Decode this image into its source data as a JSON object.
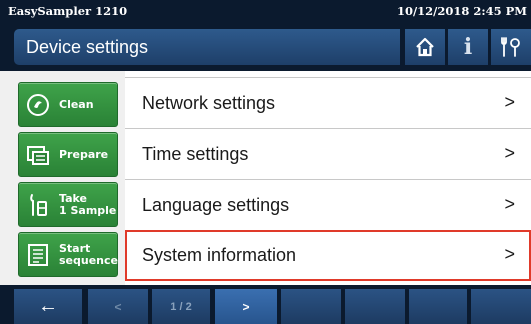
{
  "status": {
    "device_name": "EasySampler 1210",
    "datetime": "10/12/2018 2:45 PM"
  },
  "header": {
    "title": "Device settings",
    "buttons": [
      {
        "icon": "home-icon"
      },
      {
        "icon": "info-icon",
        "glyph": "i"
      },
      {
        "icon": "tools-icon"
      }
    ]
  },
  "sidebar": {
    "items": [
      {
        "label": "Clean",
        "icon": "clean-icon"
      },
      {
        "label": "Prepare",
        "icon": "prepare-icon"
      },
      {
        "label": "Take\n1 Sample",
        "icon": "take-sample-icon"
      },
      {
        "label": "Start\nsequence",
        "icon": "start-sequence-icon"
      }
    ]
  },
  "menu": {
    "items": [
      {
        "label": "Network settings",
        "chevron": ">"
      },
      {
        "label": "Time settings",
        "chevron": ">"
      },
      {
        "label": "Language settings",
        "chevron": ">"
      },
      {
        "label": "System information",
        "chevron": ">",
        "selected": true
      }
    ]
  },
  "footer": {
    "back_glyph": "←",
    "prev_label": "<",
    "page_indicator": "1 / 2",
    "next_label": ">"
  },
  "colors": {
    "frame_dark": "#0b1a2e",
    "header_blue": "#1e3f69",
    "action_green": "#2a8236",
    "selection_red": "#e03a2a"
  }
}
